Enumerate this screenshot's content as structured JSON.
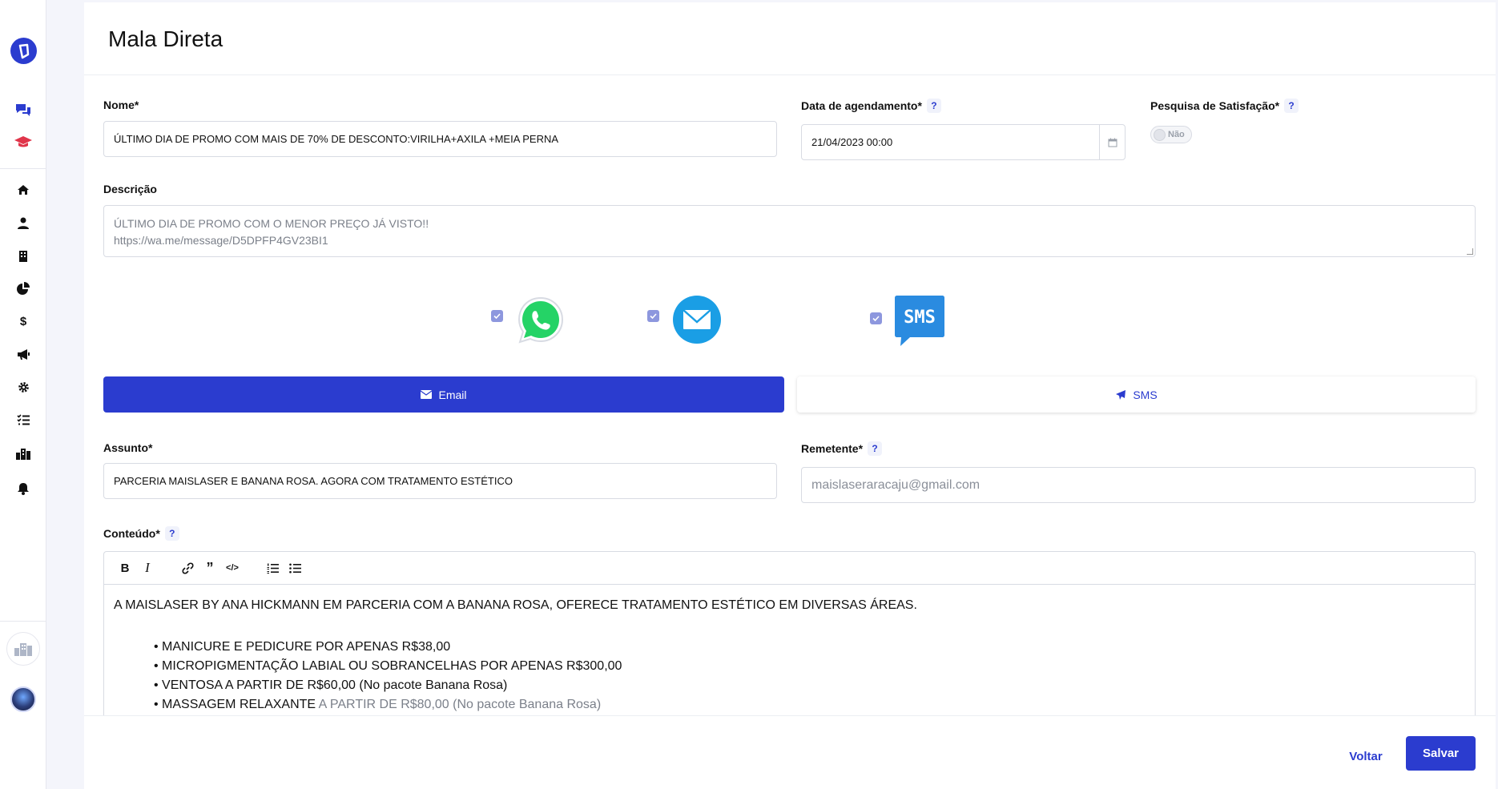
{
  "page": {
    "title": "Mala Direta"
  },
  "colors": {
    "primary": "#2b3ccf",
    "whatsapp": "#25d366",
    "email": "#1a9ee5",
    "sms": "#2a8be0"
  },
  "sidebar": {
    "items": [
      {
        "icon": "logo-icon"
      },
      {
        "icon": "chat-icon"
      },
      {
        "icon": "graduation-cap-icon"
      },
      {
        "icon": "home-icon"
      },
      {
        "icon": "user-icon"
      },
      {
        "icon": "building-icon"
      },
      {
        "icon": "pie-chart-icon"
      },
      {
        "icon": "dollar-icon"
      },
      {
        "icon": "megaphone-icon"
      },
      {
        "icon": "gear-icon"
      },
      {
        "icon": "task-list-icon"
      },
      {
        "icon": "city-icon"
      },
      {
        "icon": "bell-icon"
      }
    ]
  },
  "form": {
    "nome": {
      "label": "Nome*",
      "value": "ÚLTIMO DIA DE PROMO COM MAIS DE 70% DE DESCONTO:VIRILHA+AXILA +MEIA PERNA"
    },
    "data": {
      "label": "Data de agendamento*",
      "help": "?",
      "value": "21/04/2023 00:00"
    },
    "pesquisa": {
      "label": "Pesquisa de Satisfação*",
      "help": "?",
      "toggle_label": "Não",
      "enabled": false
    },
    "descricao": {
      "label": "Descrição",
      "line1": "ÚLTIMO DIA DE PROMO COM O MENOR PREÇO JÁ VISTO!!",
      "line2": "https://wa.me/message/D5DPFP4GV23BI1"
    },
    "channels": {
      "whatsapp": true,
      "email": true,
      "sms": true,
      "sms_icon_text": "SMS"
    },
    "tabs": {
      "email": "Email",
      "sms": "SMS",
      "active": "email"
    },
    "assunto": {
      "label": "Assunto*",
      "value": "PARCERIA MAISLASER E BANANA ROSA. AGORA COM TRATAMENTO ESTÉTICO"
    },
    "remetente": {
      "label": "Remetente*",
      "help": "?",
      "placeholder": "maislaseraracaju@gmail.com"
    },
    "conteudo": {
      "label": "Conteúdo*",
      "help": "?",
      "intro": "A MAISLASER BY ANA HICKMANN EM PARCERIA COM A BANANA ROSA, OFERECE TRATAMENTO ESTÉTICO EM DIVERSAS ÁREAS.",
      "bullets": [
        "• MANICURE E PEDICURE POR APENAS R$38,00",
        "• MICROPIGMENTAÇÃO LABIAL OU SOBRANCELHAS POR APENAS R$300,00",
        "• VENTOSA A PARTIR DE R$60,00 (No pacote Banana Rosa)"
      ],
      "last_bullet_start": "• MASSAGEM RELAXANTE ",
      "last_bullet_rest": "A PARTIR DE R$80,00 (No pacote Banana Rosa)"
    }
  },
  "footer": {
    "voltar": "Voltar",
    "salvar": "Salvar"
  }
}
